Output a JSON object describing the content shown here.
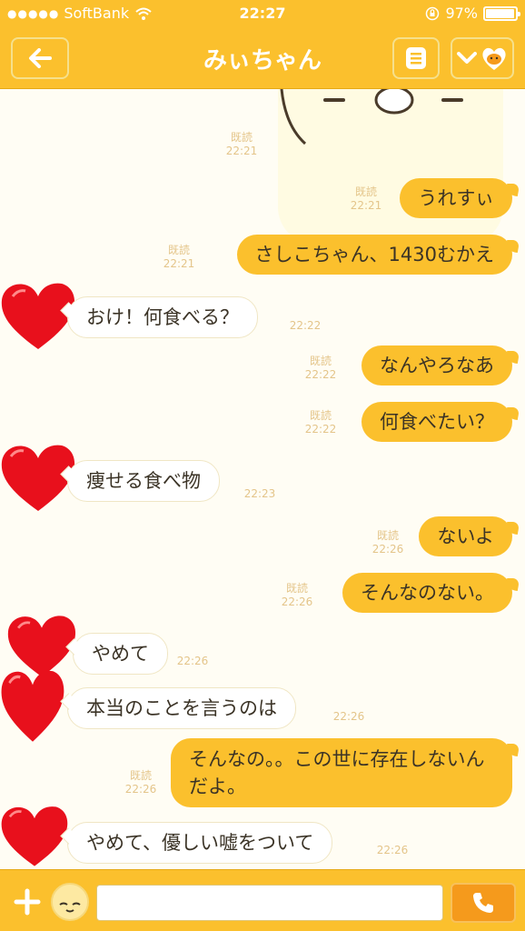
{
  "status_bar": {
    "carrier": "SoftBank",
    "time": "22:27",
    "battery_text": "97%",
    "battery_level": 0.97,
    "signal_dots": "●●●●●"
  },
  "header": {
    "title": "みぃちゃん",
    "back_icon": "arrow-left-icon",
    "menu_icon": "list-icon",
    "fav_icon": "chevron-down-icon"
  },
  "chat": {
    "messages": [
      {
        "side": "sticker",
        "read": "既読",
        "time": "22:21"
      },
      {
        "side": "out",
        "text": "うれすぃ",
        "read": "既読",
        "time": "22:21"
      },
      {
        "side": "out",
        "text": "さしこちゃん、1430むかえ",
        "read": "既読",
        "time": "22:21"
      },
      {
        "side": "in",
        "text": "おけ！何食べる？",
        "time": "22:22"
      },
      {
        "side": "out",
        "text": "なんやろなあ",
        "read": "既読",
        "time": "22:22"
      },
      {
        "side": "out",
        "text": "何食べたい？",
        "read": "既読",
        "time": "22:22"
      },
      {
        "side": "in",
        "text": "痩せる食べ物",
        "time": "22:23"
      },
      {
        "side": "out",
        "text": "ないよ",
        "read": "既読",
        "time": "22:26"
      },
      {
        "side": "out",
        "text": "そんなのない。",
        "read": "既読",
        "time": "22:26"
      },
      {
        "side": "in",
        "text": "やめて",
        "time": "22:26"
      },
      {
        "side": "in",
        "text": "本当のことを言うのは",
        "time": "22:26"
      },
      {
        "side": "out",
        "text": "そんなの。。この世に存在しないんだよ。",
        "read": "既読",
        "time": "22:26"
      },
      {
        "side": "in",
        "text": "やめて、優しい嘘をついて",
        "time": "22:26"
      }
    ]
  },
  "input_bar": {
    "placeholder": "",
    "plus_icon": "plus-icon",
    "emoji_icon": "emoji-face-icon",
    "call_icon": "phone-icon"
  },
  "colors": {
    "accent": "#fbc02d",
    "background": "#fffdf4",
    "heart": "#e8101c",
    "timestamp": "#e4c58a"
  }
}
